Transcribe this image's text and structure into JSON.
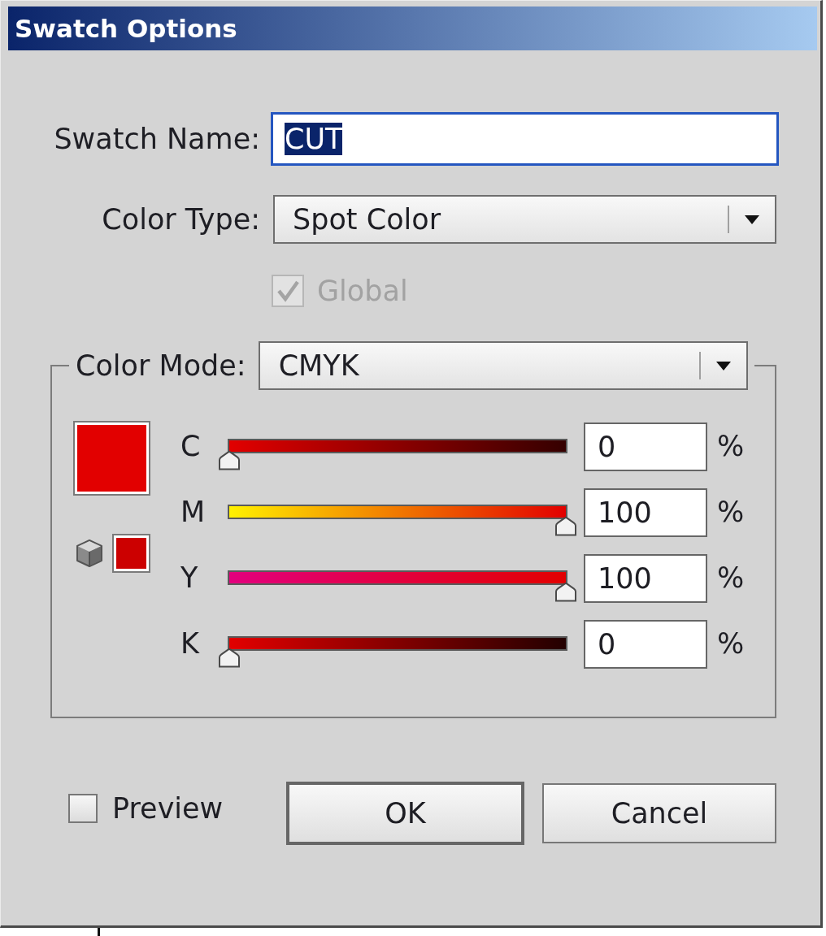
{
  "window": {
    "title": "Swatch Options"
  },
  "swatch_name": {
    "label": "Swatch Name:",
    "value": "CUT",
    "focused": true
  },
  "color_type": {
    "label": "Color Type:",
    "value": "Spot Color"
  },
  "global": {
    "label": "Global",
    "checked": true,
    "disabled": true
  },
  "color_mode": {
    "label": "Color Mode:",
    "value": "CMYK"
  },
  "channels": [
    {
      "name": "C",
      "level": 0,
      "value": "0",
      "unit": "%"
    },
    {
      "name": "M",
      "level": 1,
      "value": "100",
      "unit": "%"
    },
    {
      "name": "Y",
      "level": 1,
      "value": "100",
      "unit": "%"
    },
    {
      "name": "K",
      "level": 0,
      "value": "0",
      "unit": "%"
    }
  ],
  "preview": {
    "label": "Preview",
    "checked": false
  },
  "buttons": [
    {
      "label": "OK",
      "default": true
    },
    {
      "label": "Cancel",
      "default": false
    }
  ]
}
